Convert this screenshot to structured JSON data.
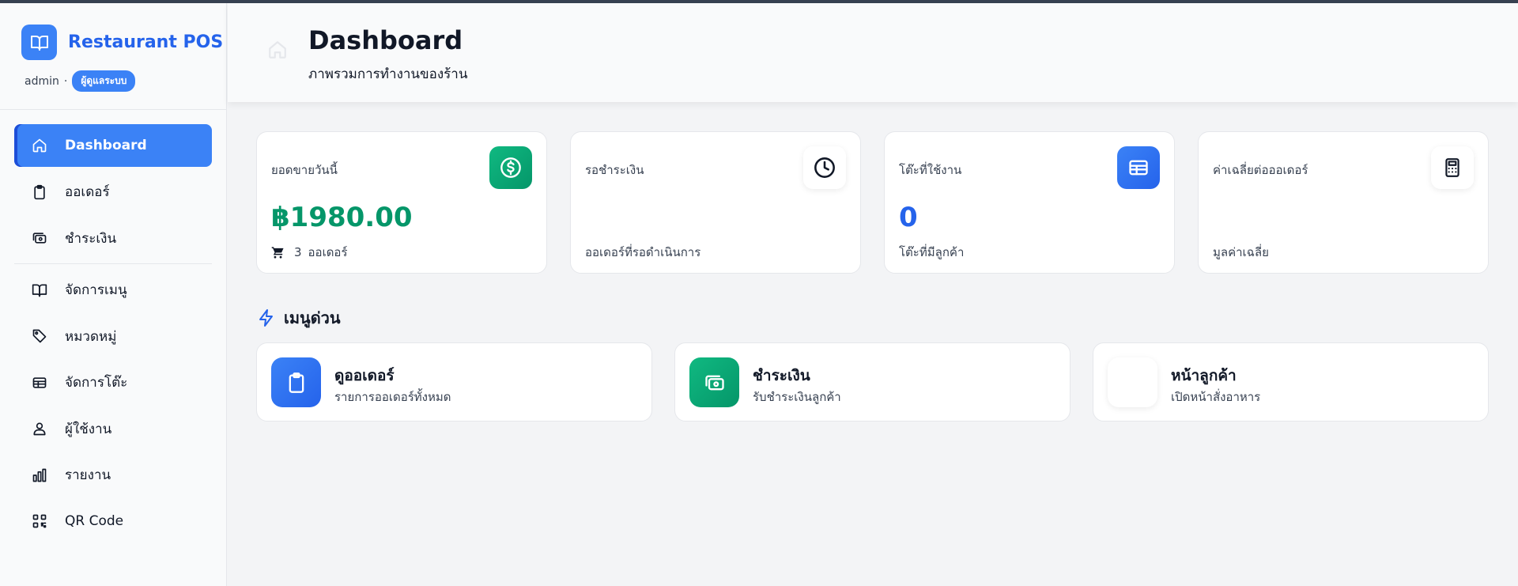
{
  "app": {
    "title": "Restaurant POS",
    "user": "admin",
    "separator": "·",
    "role": "ผู้ดูแลระบบ"
  },
  "sidebar": {
    "items": [
      {
        "label": "Dashboard",
        "icon": "home-icon",
        "active": true
      },
      {
        "label": "ออเดอร์",
        "icon": "clipboard-icon"
      },
      {
        "label": "ชำระเงิน",
        "icon": "cash-icon"
      },
      {
        "label": "จัดการเมนู",
        "icon": "book-icon"
      },
      {
        "label": "หมวดหมู่",
        "icon": "tag-icon"
      },
      {
        "label": "จัดการโต๊ะ",
        "icon": "table-icon"
      },
      {
        "label": "ผู้ใช้งาน",
        "icon": "users-icon"
      },
      {
        "label": "รายงาน",
        "icon": "bar-chart-icon"
      },
      {
        "label": "QR Code",
        "icon": "qr-code-icon"
      }
    ]
  },
  "header": {
    "title": "Dashboard",
    "subtitle": "ภาพรวมการทำงานของร้าน"
  },
  "stats": [
    {
      "label": "ยอดขายวันนี้",
      "value": "฿1980.00",
      "sub_count": "3",
      "sub_text": "ออเดอร์",
      "icon": "dollar-icon"
    },
    {
      "label": "รอชำระเงิน",
      "value": "",
      "sub_text": "ออเดอร์ที่รอดำเนินการ",
      "icon": "clock-icon"
    },
    {
      "label": "โต๊ะที่ใช้งาน",
      "value": "0",
      "sub_text": "โต๊ะที่มีลูกค้า",
      "icon": "table-icon"
    },
    {
      "label": "ค่าเฉลี่ยต่อออเดอร์",
      "value": "",
      "sub_text": "มูลค่าเฉลี่ย",
      "icon": "calculator-icon"
    }
  ],
  "quick_menu": {
    "heading": "เมนูด่วน",
    "items": [
      {
        "title": "ดูออเดอร์",
        "subtitle": "รายการออเดอร์ทั้งหมด",
        "icon": "clipboard-icon"
      },
      {
        "title": "ชำระเงิน",
        "subtitle": "รับชำระเงินลูกค้า",
        "icon": "cash-icon"
      },
      {
        "title": "หน้าลูกค้า",
        "subtitle": "เปิดหน้าสั่งอาหาร",
        "icon": ""
      }
    ]
  },
  "colors": {
    "primary": "#3b82f6",
    "success": "#059669",
    "text": "#111827"
  }
}
